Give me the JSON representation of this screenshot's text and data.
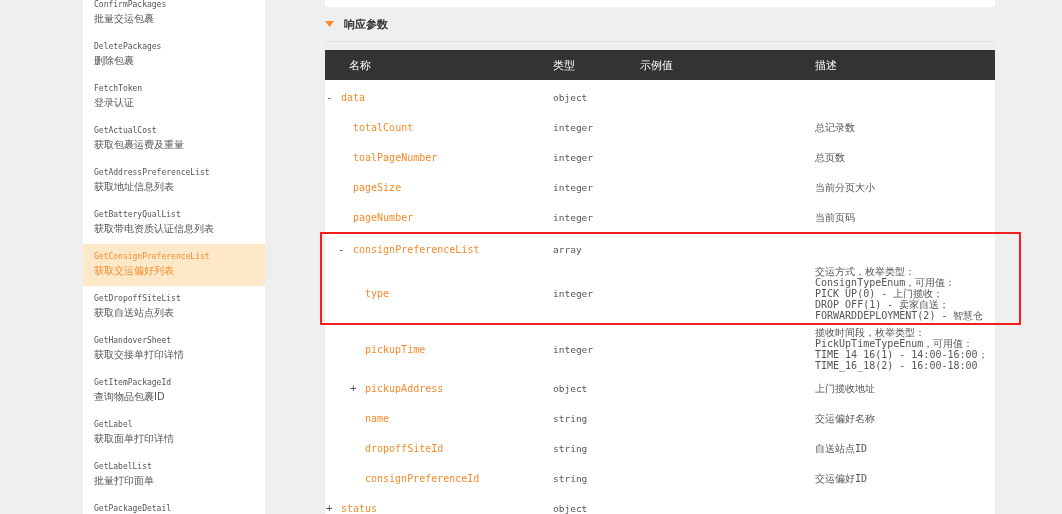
{
  "sidebar": {
    "items": [
      {
        "method": "ConfirmPackages",
        "label": "批量交运包裹",
        "selected": false
      },
      {
        "method": "DeletePackages",
        "label": "删除包裹",
        "selected": false
      },
      {
        "method": "FetchToken",
        "label": "登录认证",
        "selected": false
      },
      {
        "method": "GetActualCost",
        "label": "获取包裹运费及重量",
        "selected": false
      },
      {
        "method": "GetAddressPreferenceList",
        "label": "获取地址信息列表",
        "selected": false
      },
      {
        "method": "GetBatteryQualList",
        "label": "获取带电资质认证信息列表",
        "selected": false
      },
      {
        "method": "GetConsignPreferenceList",
        "label": "获取交运偏好列表",
        "selected": true
      },
      {
        "method": "GetDropoffSiteList",
        "label": "获取自送站点列表",
        "selected": false
      },
      {
        "method": "GetHandoverSheet",
        "label": "获取交接单打印详情",
        "selected": false
      },
      {
        "method": "GetItemPackageId",
        "label": "查询物品包裹ID",
        "selected": false
      },
      {
        "method": "GetLabel",
        "label": "获取面单打印详情",
        "selected": false
      },
      {
        "method": "GetLabelList",
        "label": "批量打印面单",
        "selected": false
      },
      {
        "method": "GetPackageDetail",
        "selected": false
      }
    ]
  },
  "section": {
    "title": "响应参数",
    "expanded": true
  },
  "table": {
    "columns": [
      "名称",
      "类型",
      "示例值",
      "描述"
    ],
    "rows": [
      {
        "name": "data",
        "type": "object",
        "toggle": "-",
        "expanded": true,
        "highlighted": false,
        "children": [
          {
            "name": "totalCount",
            "type": "integer",
            "description": "总记录数",
            "highlighted": false
          },
          {
            "name": "toalPageNumber",
            "type": "integer",
            "description": "总页数",
            "highlighted": false
          },
          {
            "name": "pageSize",
            "type": "integer",
            "description": "当前分页大小",
            "highlighted": false
          },
          {
            "name": "pageNumber",
            "type": "integer",
            "description": "当前页码",
            "highlighted": false
          },
          {
            "name": "consignPreferenceList",
            "type": "array",
            "toggle": "-",
            "expanded": true,
            "highlighted": true,
            "children": [
              {
                "name": "type",
                "type": "integer",
                "description": "交运方式，枚举类型：\nConsignTypeEnum，可用值：\nPICK UP(0) - 上门揽收；\nDROP OFF(1) - 卖家自送；\nFORWARDDEPLOYMENT(2) - 智慧仓",
                "highlighted": true
              },
              {
                "name": "pickupTime",
                "type": "integer",
                "description": "揽收时间段，枚举类型：\nPickUpTimeTypeEnum，可用值：\nTIME 14 16(1) - 14:00-16:00；\nTIME_16_18(2) - 16:00-18:00",
                "highlighted": false
              },
              {
                "name": "pickupAddress",
                "type": "object",
                "toggle": "+",
                "expanded": false,
                "description": "上门揽收地址",
                "highlighted": false
              },
              {
                "name": "name",
                "type": "string",
                "description": "交运偏好名称",
                "highlighted": false
              },
              {
                "name": "dropoffSiteId",
                "type": "string",
                "description": "自送站点ID",
                "highlighted": false
              },
              {
                "name": "consignPreferenceId",
                "type": "string",
                "description": "交运偏好ID",
                "highlighted": false
              }
            ]
          }
        ]
      },
      {
        "name": "status",
        "type": "object",
        "toggle": "+",
        "expanded": false,
        "highlighted": false
      }
    ]
  }
}
